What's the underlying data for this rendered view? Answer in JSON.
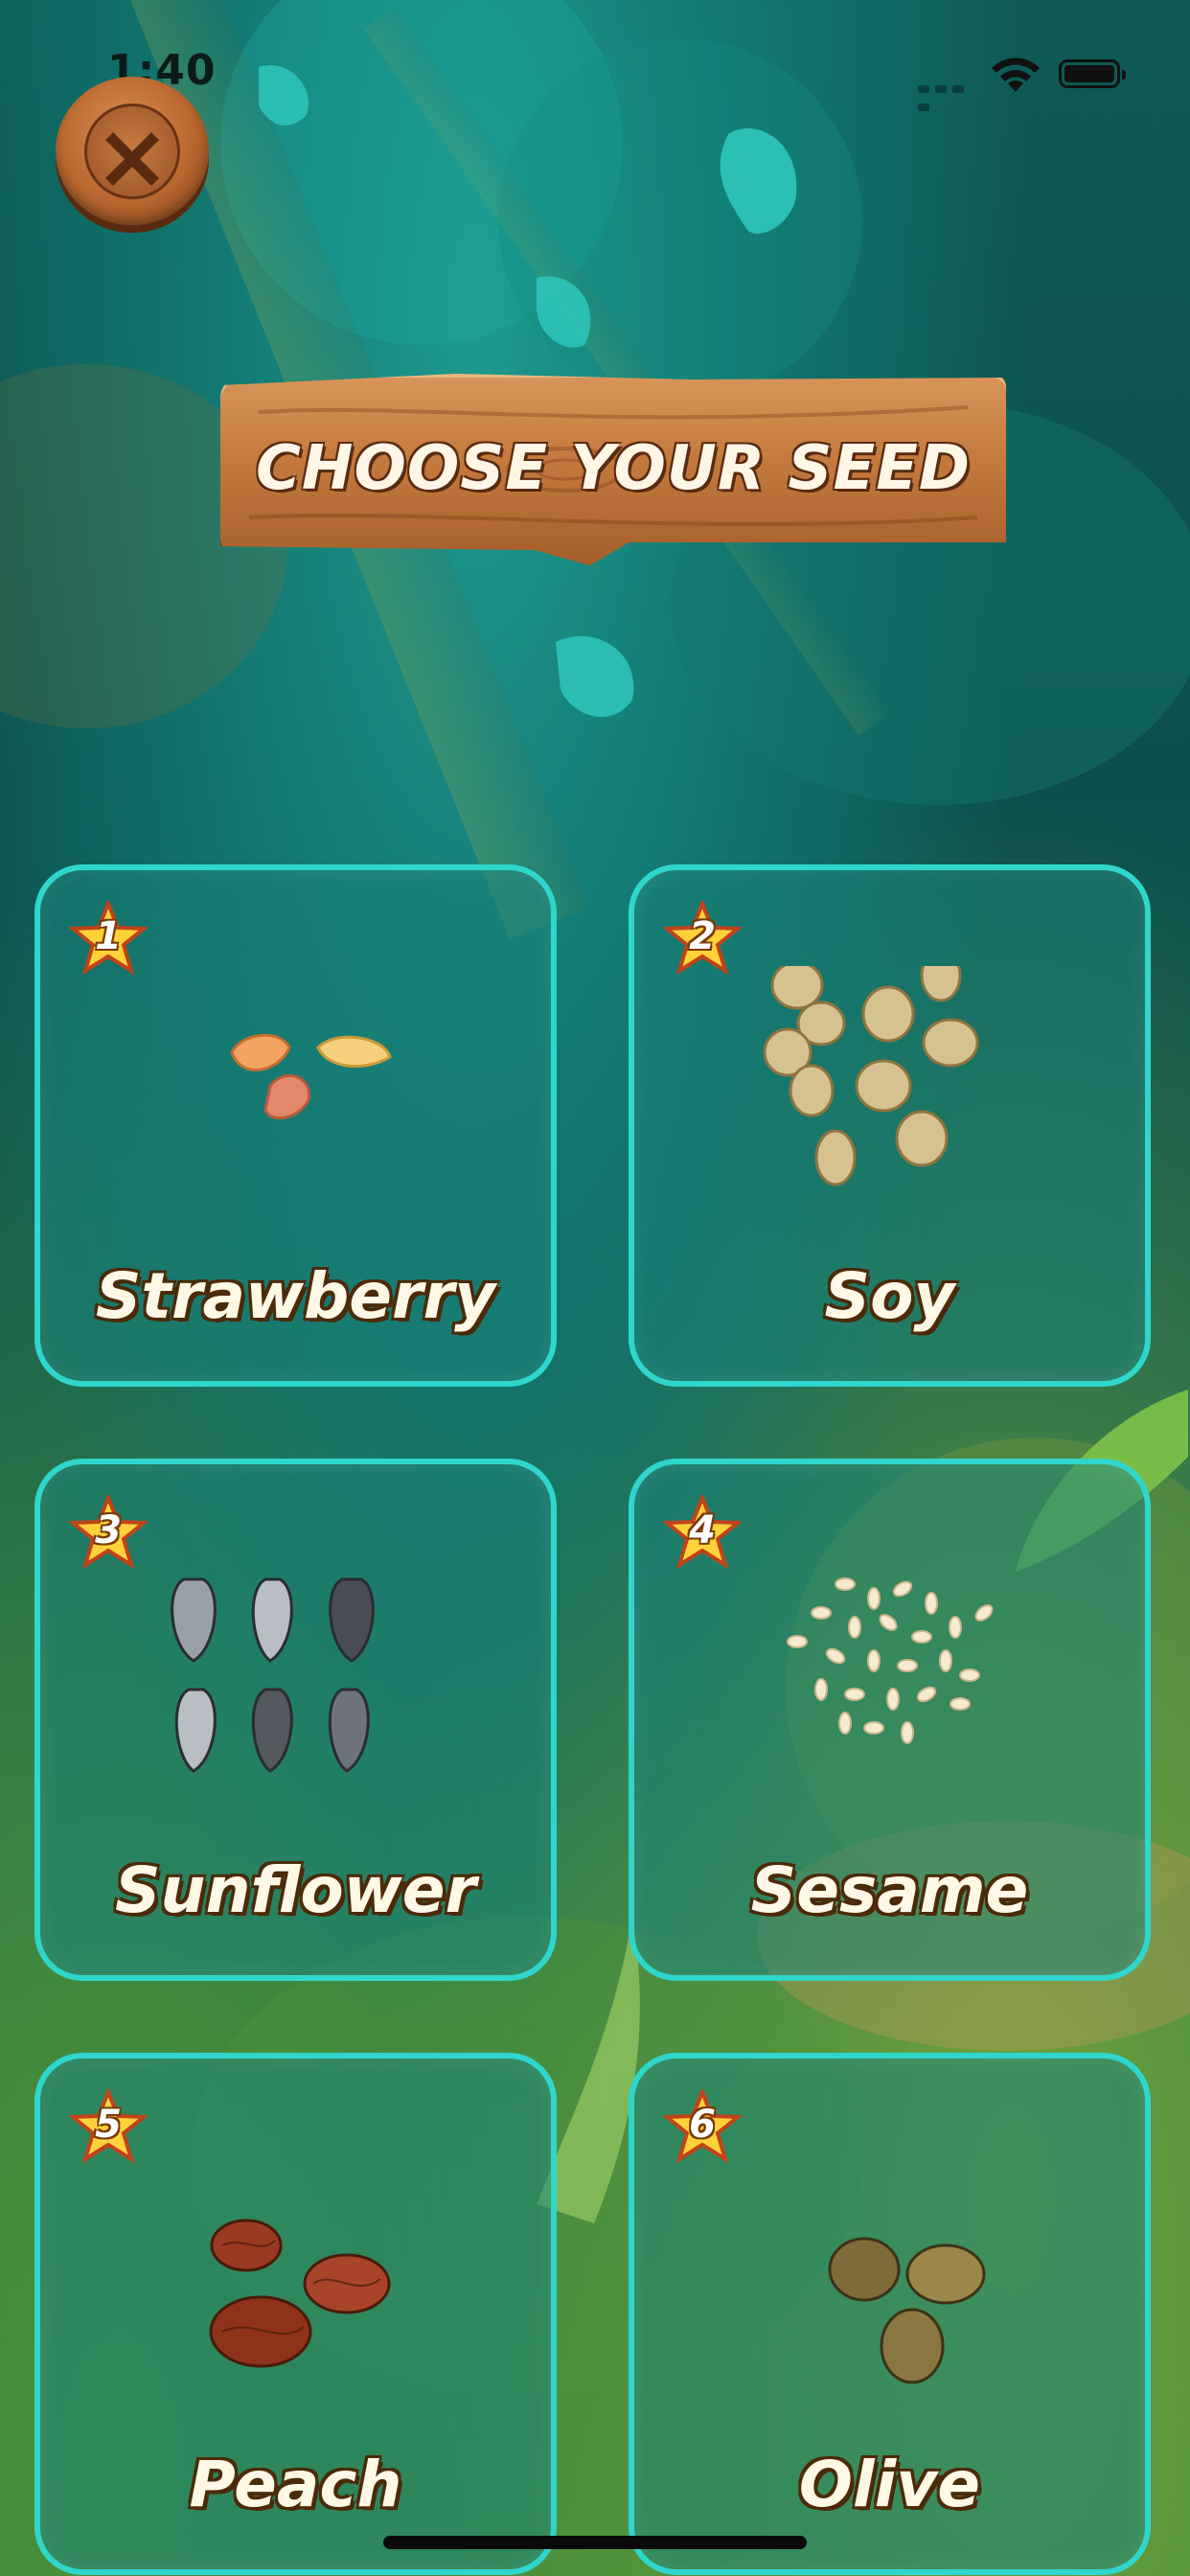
{
  "status_bar": {
    "time": "1:40"
  },
  "header": {
    "title": "CHOOSE YOUR SEED"
  },
  "close_button": {
    "icon": "close-icon"
  },
  "seeds": [
    {
      "number": "1",
      "name": "Strawberry",
      "icon": "strawberry-seeds-icon"
    },
    {
      "number": "2",
      "name": "Soy",
      "icon": "soy-seeds-icon"
    },
    {
      "number": "3",
      "name": "Sunflower",
      "icon": "sunflower-seeds-icon"
    },
    {
      "number": "4",
      "name": "Sesame",
      "icon": "sesame-seeds-icon"
    },
    {
      "number": "5",
      "name": "Peach",
      "icon": "peach-seeds-icon"
    },
    {
      "number": "6",
      "name": "Olive",
      "icon": "olive-seeds-icon"
    }
  ],
  "colors": {
    "card_border": "#2fd6cc",
    "card_fill": "#19827a",
    "sign_wood": "#c47a3e",
    "label_outline": "#4b2a0a"
  }
}
